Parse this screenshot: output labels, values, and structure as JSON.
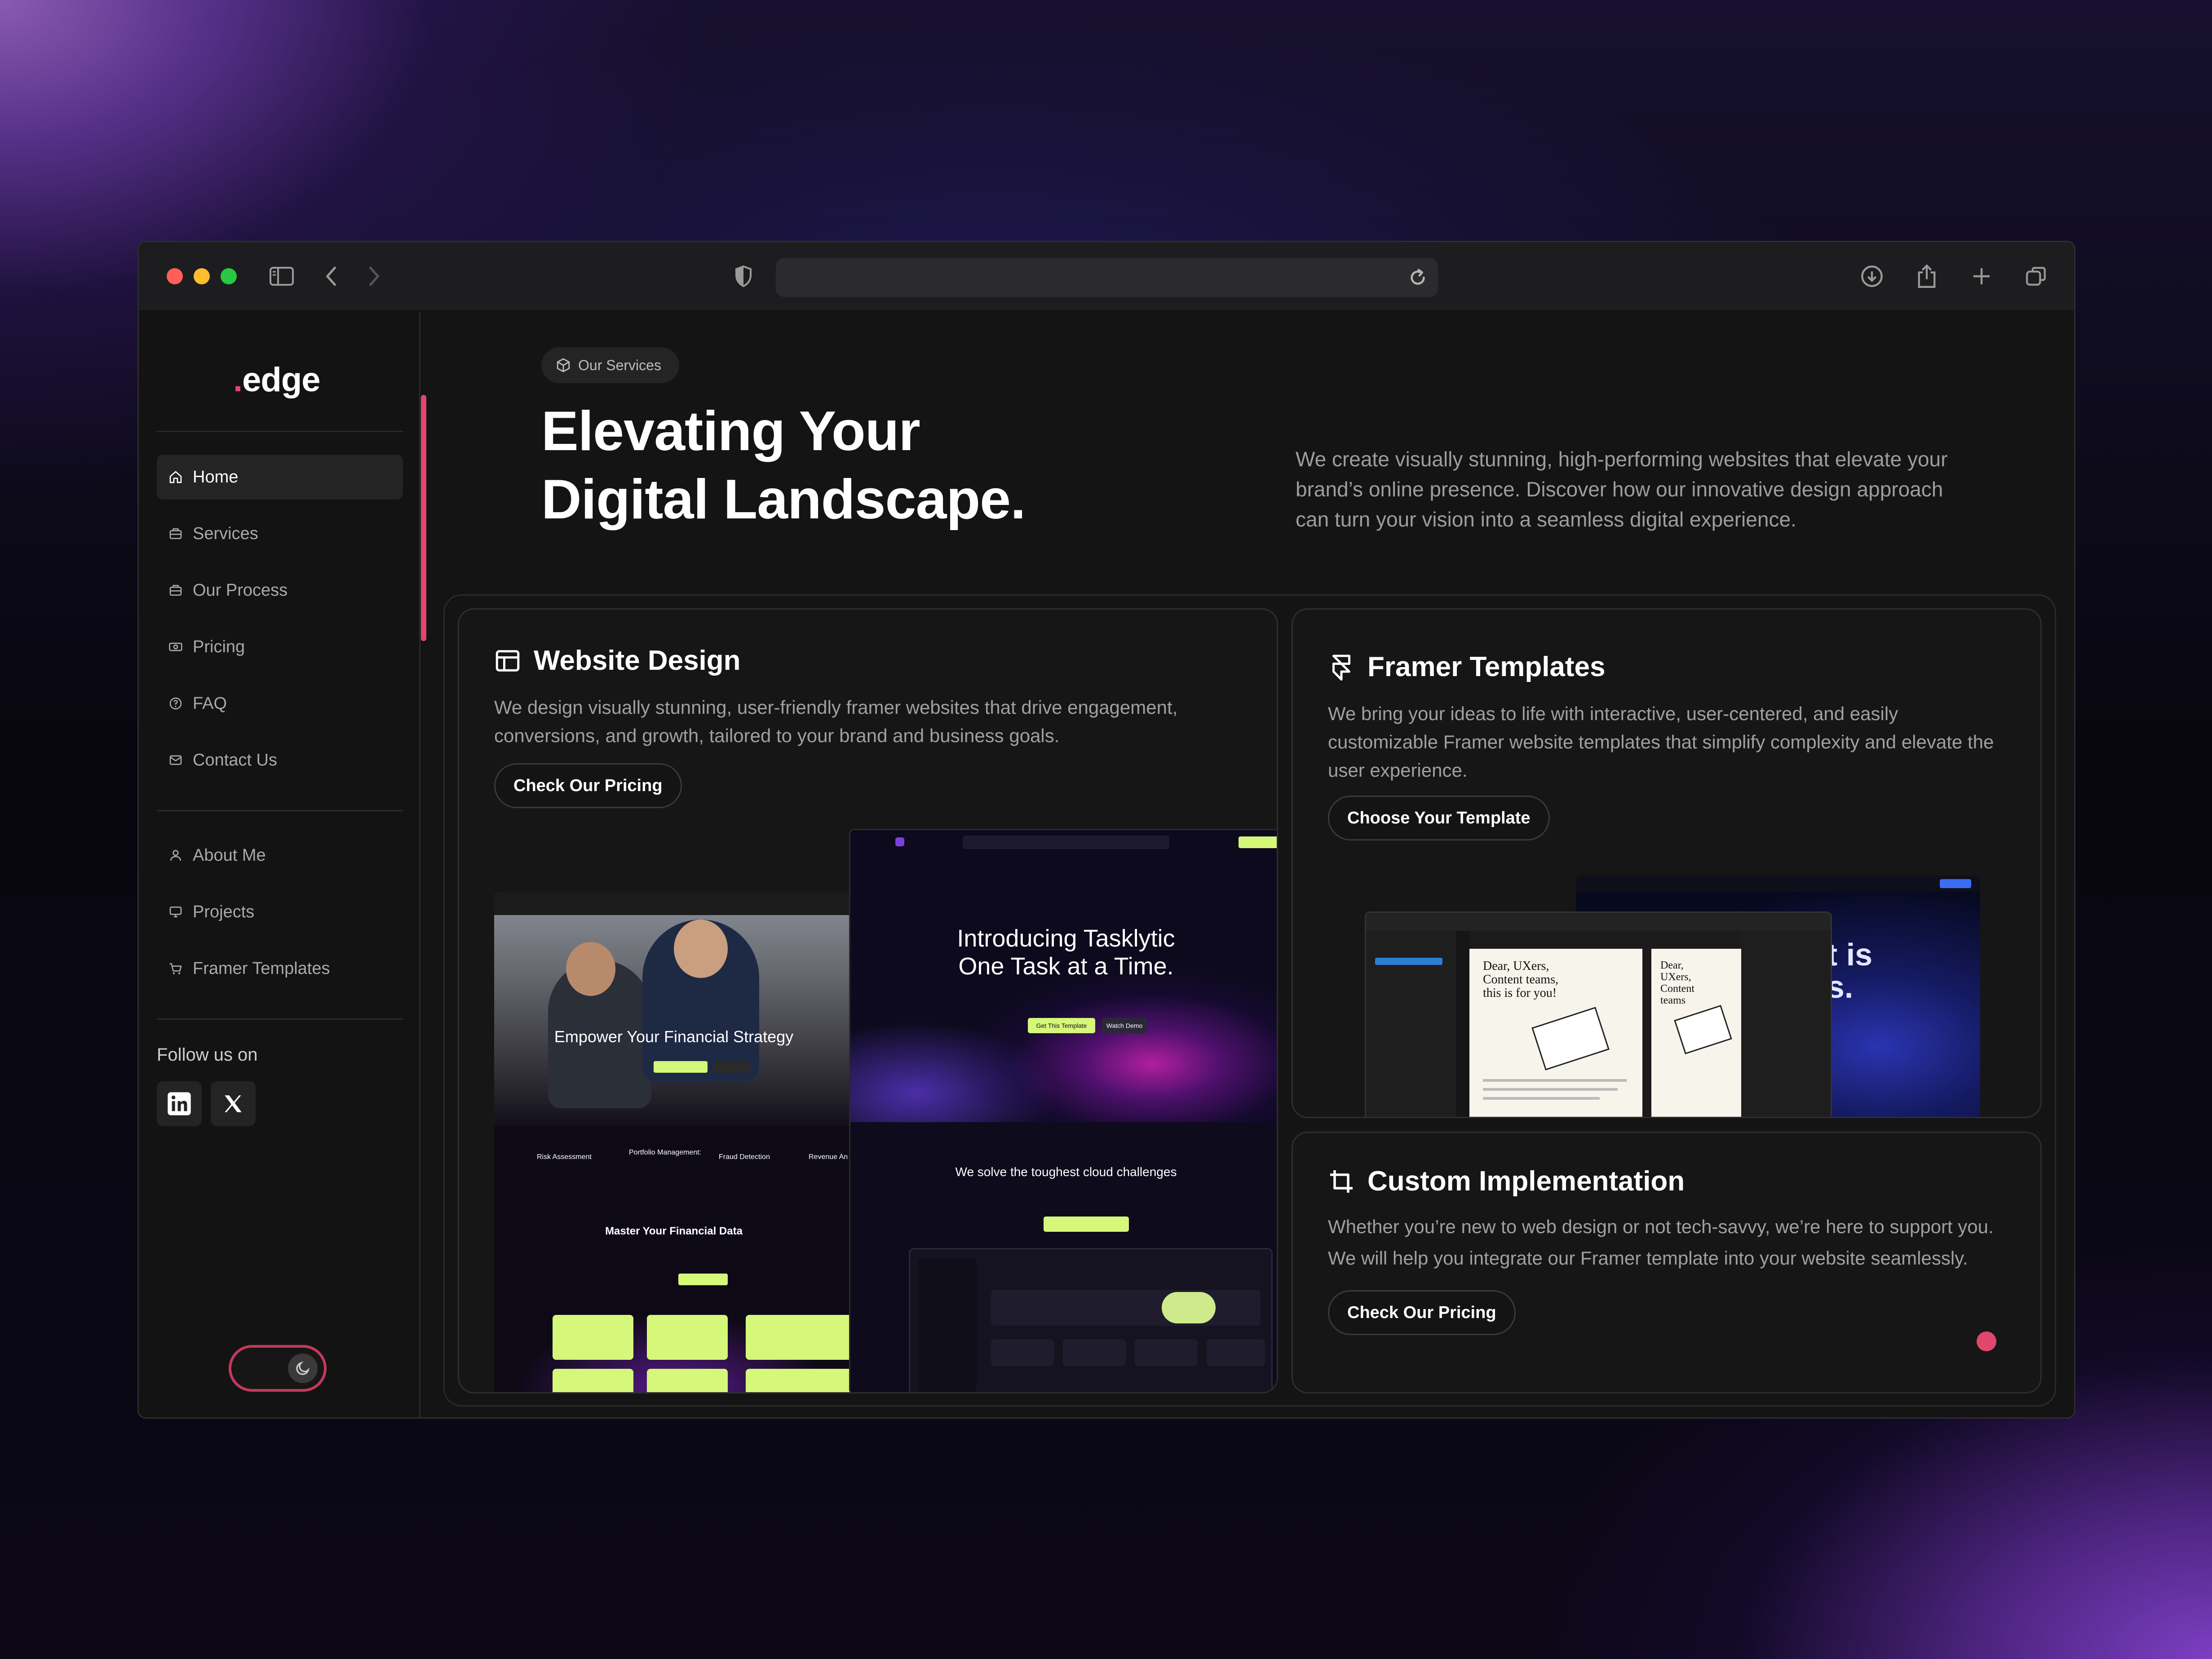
{
  "browser": {
    "url": "",
    "colors": {
      "close": "#ff5f57",
      "minimize": "#febc2e",
      "zoom": "#28c840"
    }
  },
  "sidebar": {
    "logo": "edge",
    "nav_primary": [
      {
        "label": "Home",
        "icon": "home-icon",
        "active": true
      },
      {
        "label": "Services",
        "icon": "briefcase-icon"
      },
      {
        "label": "Our Process",
        "icon": "briefcase-icon"
      },
      {
        "label": "Pricing",
        "icon": "money-icon"
      },
      {
        "label": "FAQ",
        "icon": "help-icon"
      },
      {
        "label": "Contact Us",
        "icon": "mail-icon"
      }
    ],
    "nav_secondary": [
      {
        "label": "About Me",
        "icon": "user-icon"
      },
      {
        "label": "Projects",
        "icon": "monitor-icon"
      },
      {
        "label": "Framer Templates",
        "icon": "cart-icon"
      }
    ],
    "follow_label": "Follow us on",
    "social": [
      "linkedin-icon",
      "x-icon"
    ],
    "accent": "#e0476c"
  },
  "hero": {
    "badge": "Our Services",
    "title_line1": "Elevating Your",
    "title_line2": "Digital Landscape.",
    "description": "We create visually stunning, high-performing websites that elevate your brand’s online presence. Discover how our innovative design approach can turn your vision into a seamless digital experience."
  },
  "cards": {
    "website_design": {
      "title": "Website Design",
      "description": "We design visually stunning, user-friendly framer websites that drive engagement, conversions, and growth, tailored to your brand and business goals.",
      "button": "Check Our Pricing"
    },
    "framer_templates": {
      "title": "Framer Templates",
      "description": "We bring your ideas to life with interactive, user-centered, and easily customizable Framer website templates that simplify complexity and elevate the user experience.",
      "button": "Choose Your Template"
    },
    "custom_implementation": {
      "title": "Custom Implementation",
      "description": "Whether you’re new to web design or not tech-savvy, we’re here to support you. We will help you integrate our Framer template into your website seamlessly.",
      "button": "Check Our Pricing"
    }
  },
  "previews": {
    "finance": {
      "headline": "Empower Your Financial Strategy",
      "features": [
        "Risk Assessment",
        "Portfolio Management:",
        "Fraud Detection",
        "Revenue An"
      ],
      "section": "Master Your Financial Data"
    },
    "tasklytic": {
      "headline_line1": "Introducing Tasklytic",
      "headline_line2": "One Task at a Time.",
      "cta_primary": "Get This Template",
      "cta_secondary": "Watch Demo",
      "section": "We solve the toughest cloud challenges"
    },
    "framer_editor": {
      "doc_text_1": "Dear, UXers, Content teams, this is for you!",
      "doc_text_2": "Dear, UXers, Content teams",
      "bg_text": "et is as."
    }
  }
}
